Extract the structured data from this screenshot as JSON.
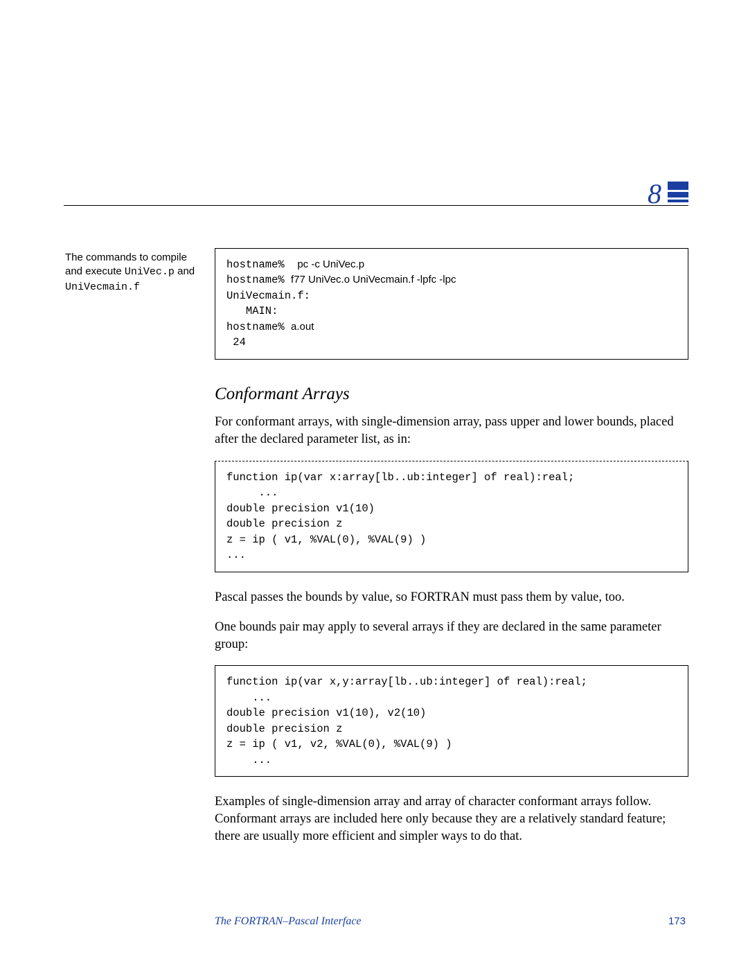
{
  "chapter_number": "8",
  "sidenote": {
    "line1_prefix": "The commands to compile and",
    "line2_prefix": "execute ",
    "code1": "UniVec.p",
    "line2_suffix": " and",
    "code2": "UniVecmain.f"
  },
  "codebox1": {
    "l1_mono": "hostname%  ",
    "l1_sans": "pc -c UniVec.p",
    "l2_mono": "hostname% ",
    "l2_sans": "f77 UniVec.o UniVecmain.f -lpfc -lpc",
    "l3": "UniVecmain.f:",
    "l4": "   MAIN:",
    "l5_mono": "hostname% ",
    "l5_sans": "a.out",
    "l6": " 24"
  },
  "section_heading": "Conformant Arrays",
  "para1": "For conformant arrays, with single-dimension array, pass upper and lower bounds, placed after the declared parameter list, as in:",
  "codebox2": "function ip(var x:array[lb..ub:integer] of real):real;\n     ...\ndouble precision v1(10)\ndouble precision z\nz = ip ( v1, %VAL(0), %VAL(9) )\n...",
  "para2": "Pascal passes the bounds by value, so FORTRAN must pass them by value, too.",
  "para3": "One bounds pair may apply to several arrays if they are declared in the same parameter group:",
  "codebox3": "function ip(var x,y:array[lb..ub:integer] of real):real;\n    ...\ndouble precision v1(10), v2(10)\ndouble precision z\nz = ip ( v1, v2, %VAL(0), %VAL(9) )\n    ...",
  "para4": "Examples of single-dimension array and array of character conformant arrays follow.  Conformant arrays are included here only because they are a relatively standard feature; there are usually more efficient and simpler ways to do that.",
  "footer_title": "The FORTRAN–Pascal Interface",
  "footer_page": "173"
}
